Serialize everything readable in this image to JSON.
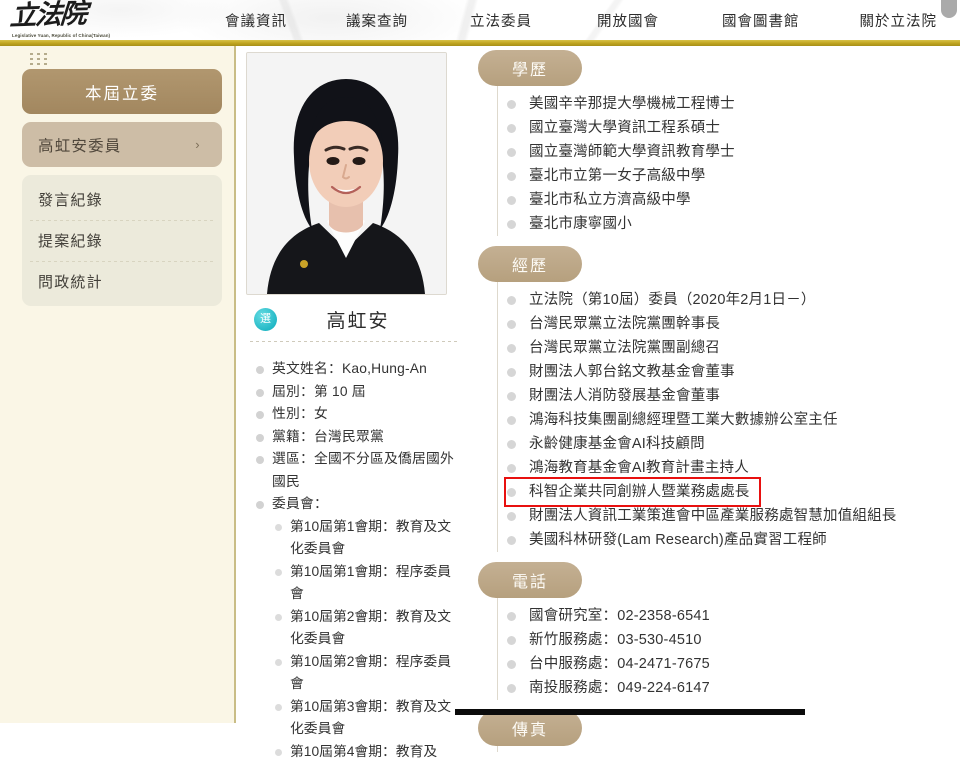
{
  "header": {
    "logo_cn": "立法院",
    "logo_en": "Legislative Yuan, Republic of China(Taiwan)",
    "nav": [
      {
        "label": "會議資訊"
      },
      {
        "label": "議案查詢"
      },
      {
        "label": "立法委員"
      },
      {
        "label": "開放國會"
      },
      {
        "label": "國會圖書館"
      },
      {
        "label": "關於立法院"
      }
    ],
    "accent_stripe": "#c8b02a"
  },
  "sidebar": {
    "current_label": "本屆立委",
    "member_label": "高虹安委員",
    "member_chevron": "›",
    "sub_items": [
      {
        "label": "發言紀錄"
      },
      {
        "label": "提案紀錄"
      },
      {
        "label": "問政統計"
      }
    ]
  },
  "profile": {
    "name": "高虹安",
    "badge_text": "選",
    "badge_color": "#2fc4cf",
    "facts": [
      "英文姓名：Kao,Hung-An",
      "屆別：第 10 屆",
      "性別：女",
      "黨籍：台灣民眾黨",
      "選區：全國不分區及僑居國外國民",
      "委員會："
    ],
    "committees": [
      "第10屆第1會期：教育及文化委員會",
      "第10屆第1會期：程序委員會",
      "第10屆第2會期：教育及文化委員會",
      "第10屆第2會期：程序委員會",
      "第10屆第3會期：教育及文化委員會",
      "第10屆第4會期：教育及"
    ]
  },
  "content": {
    "education": {
      "title": "學歷",
      "items": [
        "美國辛辛那提大學機械工程博士",
        "國立臺灣大學資訊工程系碩士",
        "國立臺灣師範大學資訊教育學士",
        "臺北市立第一女子高級中學",
        "臺北市私立方濟高級中學",
        "臺北市康寧國小"
      ]
    },
    "experience": {
      "title": "經歷",
      "items": [
        "立法院（第10屆）委員（2020年2月1日－）",
        "台灣民眾黨立法院黨團幹事長",
        "台灣民眾黨立法院黨團副總召",
        "財團法人郭台銘文教基金會董事",
        "財團法人消防發展基金會董事",
        "鴻海科技集團副總經理暨工業大數據辦公室主任",
        "永齡健康基金會AI科技顧問",
        "鴻海教育基金會AI教育計畫主持人",
        "科智企業共同創辦人暨業務處處長",
        "財團法人資訊工業策進會中區產業服務處智慧加值組組長",
        "美國科林研發(Lam Research)產品實習工程師"
      ],
      "highlight_index": 8,
      "highlight_color": "#e8100f"
    },
    "phone": {
      "title": "電話",
      "items": [
        "國會研究室：02-2358-6541",
        "新竹服務處：03-530-4510",
        "台中服務處：04-2471-7675",
        "南投服務處：049-224-6147"
      ]
    },
    "fax": {
      "title": "傳真",
      "items": []
    }
  }
}
